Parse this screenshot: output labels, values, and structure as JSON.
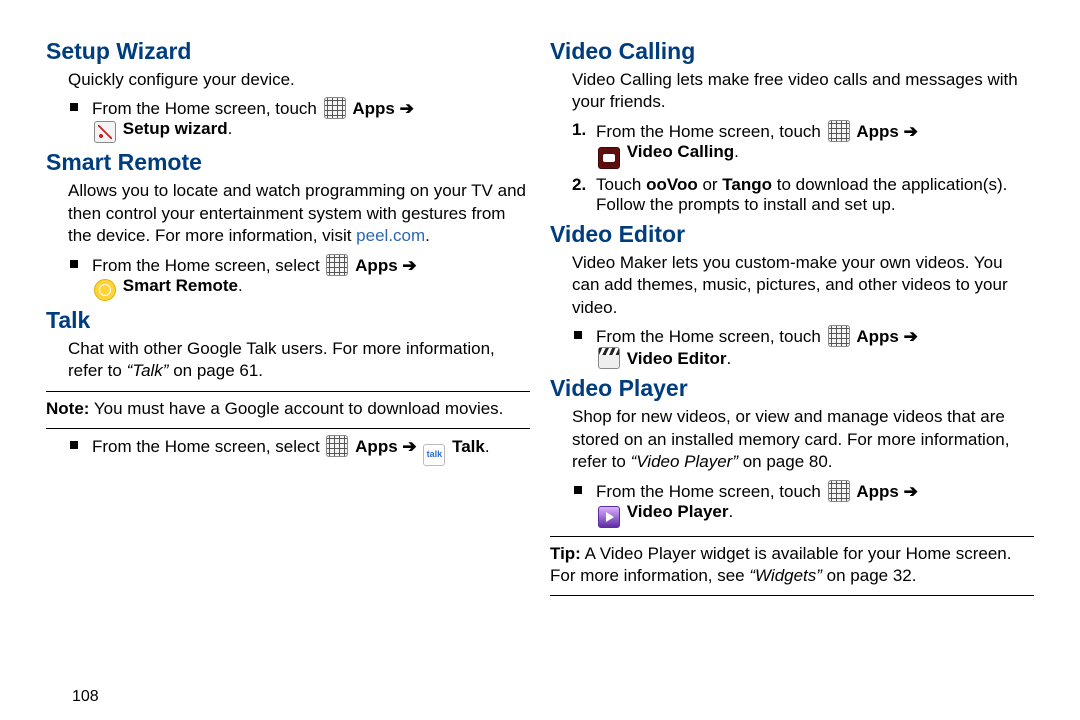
{
  "pageNumber": "108",
  "left": {
    "setupWizard": {
      "heading": "Setup Wizard",
      "intro": "Quickly configure your device.",
      "step_a": "From the Home screen, touch ",
      "apps": "Apps",
      "label": "Setup wizard"
    },
    "smartRemote": {
      "heading": "Smart Remote",
      "intro_a": "Allows you to locate and watch programming on your TV and then control your entertainment system with gestures from the device. For more information, visit ",
      "link": "peel.com",
      "intro_b": ".",
      "step_a": "From the Home screen, select ",
      "apps": "Apps",
      "label": "Smart Remote"
    },
    "talk": {
      "heading": "Talk",
      "intro_a": "Chat with other Google Talk users. For more information, refer to ",
      "ref": "“Talk”",
      "intro_b": " on page 61.",
      "note_label": "Note:",
      "note": "You must have a Google account to download movies.",
      "step_a": "From the Home screen, select ",
      "apps": "Apps",
      "label": "Talk"
    }
  },
  "right": {
    "videoCalling": {
      "heading": "Video Calling",
      "intro": "Video Calling lets make free video calls and messages with your friends.",
      "step1_a": "From the Home screen, touch ",
      "apps": "Apps",
      "label": "Video Calling",
      "step2_a": "Touch ",
      "oovoo": "ooVoo",
      "or": " or ",
      "tango": "Tango",
      "step2_b": " to download the application(s). Follow the prompts to install and set up."
    },
    "videoEditor": {
      "heading": "Video Editor",
      "intro": "Video Maker lets you custom-make your own videos. You can add themes, music, pictures, and other videos to your video.",
      "step_a": "From the Home screen, touch ",
      "apps": "Apps",
      "label": "Video Editor"
    },
    "videoPlayer": {
      "heading": "Video Player",
      "intro_a": "Shop for new videos, or view and manage videos that are stored on an installed memory card. For more information, refer to ",
      "ref": "“Video Player”",
      "intro_b": " on page 80.",
      "step_a": "From the Home screen, touch ",
      "apps": "Apps",
      "label": "Video Player",
      "tip_label": "Tip:",
      "tip_a": "A Video Player widget is available for your Home screen. For more information, see ",
      "tip_ref": "“Widgets”",
      "tip_b": " on page 32."
    }
  }
}
